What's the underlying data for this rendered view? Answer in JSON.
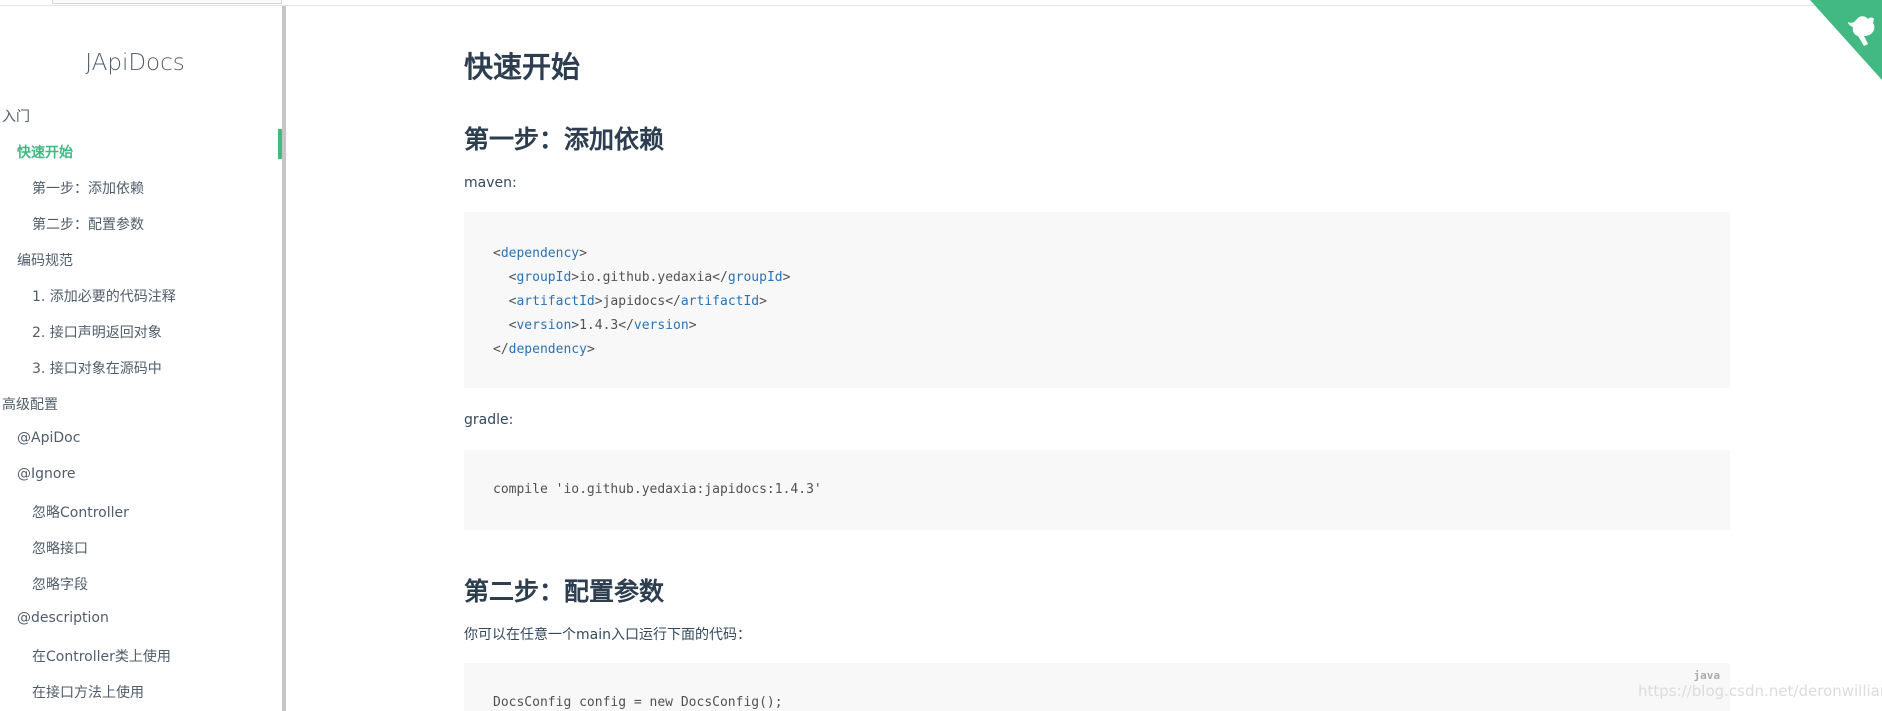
{
  "sidebar": {
    "app_name": "JApiDocs",
    "items": [
      {
        "label": "入门"
      },
      {
        "label": "快速开始"
      },
      {
        "label": "第一步：添加依赖"
      },
      {
        "label": "第二步：配置参数"
      },
      {
        "label": "编码规范"
      },
      {
        "label": "1. 添加必要的代码注释"
      },
      {
        "label": "2. 接口声明返回对象"
      },
      {
        "label": "3. 接口对象在源码中"
      },
      {
        "label": "高级配置"
      },
      {
        "label": "@ApiDoc"
      },
      {
        "label": "@Ignore"
      },
      {
        "label": "忽略Controller"
      },
      {
        "label": "忽略接口"
      },
      {
        "label": "忽略字段"
      },
      {
        "label": "@description"
      },
      {
        "label": "在Controller类上使用"
      },
      {
        "label": "在接口方法上使用"
      }
    ],
    "active_color": "#42b983"
  },
  "content": {
    "title": "快速开始",
    "step1_heading": "第一步：添加依赖",
    "maven_label": "maven:",
    "maven_code": {
      "l1_open": "<",
      "l1_tag": "dependency",
      "l1_close": ">",
      "l2_indent": "  <",
      "l2_tag": "groupId",
      "l2_mid": ">io.github.yedaxia</",
      "l2_tag2": "groupId",
      "l2_close": ">",
      "l3_indent": "  <",
      "l3_tag": "artifactId",
      "l3_mid": ">japidocs</",
      "l3_tag2": "artifactId",
      "l3_close": ">",
      "l4_indent": "  <",
      "l4_tag": "version",
      "l4_mid": ">1.4.3</",
      "l4_tag2": "version",
      "l4_close": ">",
      "l5_open": "</",
      "l5_tag": "dependency",
      "l5_close": ">"
    },
    "gradle_label": "gradle:",
    "gradle_code": "compile 'io.github.yedaxia:japidocs:1.4.3'",
    "step2_heading": "第二步：配置参数",
    "step2_text": "你可以在任意一个main入口运行下面的代码：",
    "java_lang_label": "java",
    "java_code_line1": "DocsConfig config = new DocsConfig();"
  },
  "watermark": "https://blog.csdn.net/deronwilliam",
  "colors": {
    "accent": "#42b983",
    "tag": "#2973b7",
    "heading": "#2c3e50"
  },
  "icons": {
    "github_corner": "github-octocat-icon"
  }
}
